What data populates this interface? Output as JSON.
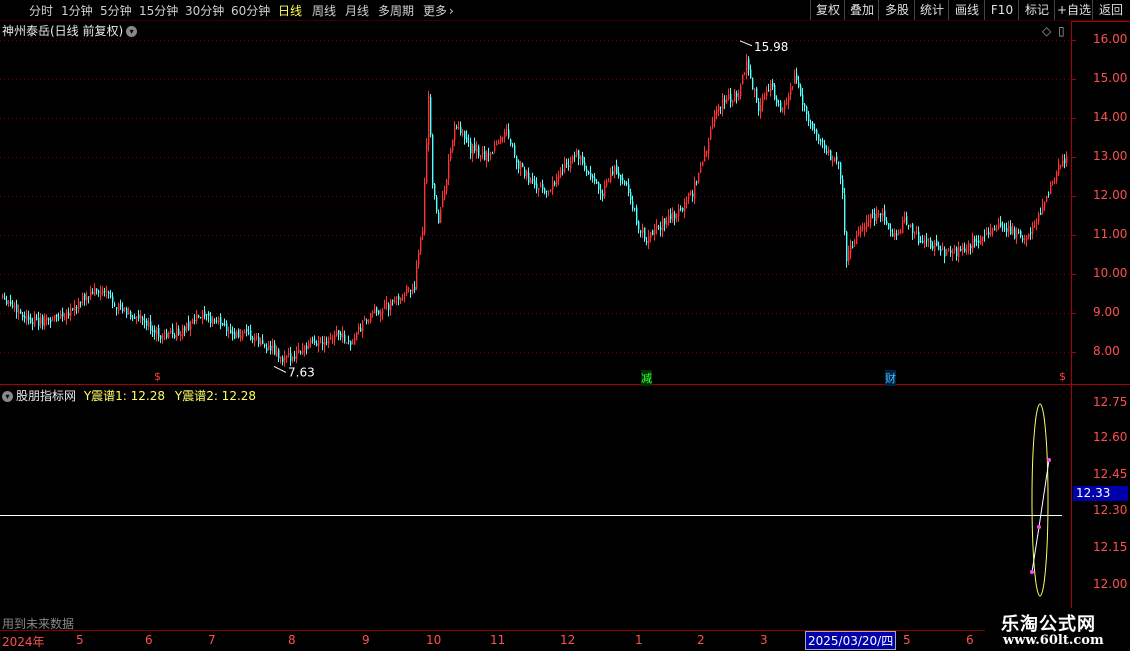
{
  "toolbar": {
    "periods": [
      "分时",
      "1分钟",
      "5分钟",
      "15分钟",
      "30分钟",
      "60分钟",
      "日线",
      "周线",
      "月线",
      "多周期",
      "更多"
    ],
    "active": "日线",
    "more_icon": "chevron-right-icon",
    "right_buttons": [
      "复权",
      "叠加",
      "多股",
      "统计",
      "画线",
      "F10",
      "标记",
      "+自选",
      "返回"
    ]
  },
  "main_chart": {
    "title": "神州泰岳(日线 前复权)",
    "max_label": "15.98",
    "min_label": "7.63",
    "y_ticks": [
      "16.00",
      "15.00",
      "14.00",
      "13.00",
      "12.00",
      "11.00",
      "10.00",
      "9.00",
      "8.00"
    ],
    "events": [
      {
        "label": "$",
        "color": "#ff4040"
      },
      {
        "label": "减",
        "color": "#40ff40"
      },
      {
        "label": "财",
        "color": "#40c0ff"
      },
      {
        "label": "$",
        "color": "#ff4040"
      }
    ]
  },
  "indicator": {
    "name": "股朋指标网",
    "series": [
      {
        "label": "Y震谱1: 12.28"
      },
      {
        "label": "Y震谱2: 12.28"
      }
    ],
    "y_ticks": [
      "12.75",
      "12.60",
      "12.45",
      "12.30",
      "12.15",
      "12.00"
    ],
    "current_price": "12.33",
    "future_note": "用到未来数据"
  },
  "date_axis": {
    "labels": [
      "2024年",
      "5",
      "6",
      "7",
      "8",
      "9",
      "10",
      "11",
      "12",
      "1",
      "2",
      "3",
      "2025/03/20/四",
      "5",
      "6"
    ]
  },
  "brand": {
    "name": "乐淘公式网",
    "url": "www.60lt.com"
  },
  "chart_data": {
    "type": "candlestick",
    "title": "神州泰岳(日线 前复权)",
    "ylim": [
      7.4,
      16.3
    ],
    "up_color": "#ff3232",
    "down_color": "#54ffff",
    "anchors": [
      [
        0,
        9.45
      ],
      [
        10,
        8.95
      ],
      [
        18,
        8.75
      ],
      [
        25,
        8.85
      ],
      [
        35,
        9.1
      ],
      [
        45,
        9.55
      ],
      [
        52,
        9.5
      ],
      [
        60,
        9.05
      ],
      [
        68,
        8.85
      ],
      [
        80,
        8.4
      ],
      [
        90,
        8.55
      ],
      [
        98,
        8.9
      ],
      [
        110,
        8.75
      ],
      [
        115,
        8.45
      ],
      [
        123,
        8.4
      ],
      [
        130,
        8.2
      ],
      [
        135,
        8.05
      ],
      [
        140,
        7.75
      ],
      [
        150,
        8.1
      ],
      [
        160,
        8.3
      ],
      [
        168,
        8.5
      ],
      [
        174,
        8.2
      ],
      [
        180,
        8.7
      ],
      [
        187,
        9.05
      ],
      [
        194,
        9.2
      ],
      [
        200,
        9.5
      ],
      [
        206,
        9.7
      ],
      [
        210,
        11.2
      ],
      [
        213,
        14.6
      ],
      [
        215,
        12.4
      ],
      [
        218,
        11.3
      ],
      [
        222,
        12.5
      ],
      [
        226,
        13.8
      ],
      [
        234,
        13.2
      ],
      [
        242,
        13.0
      ],
      [
        252,
        13.7
      ],
      [
        258,
        12.8
      ],
      [
        265,
        12.3
      ],
      [
        272,
        12.1
      ],
      [
        280,
        12.7
      ],
      [
        287,
        13.1
      ],
      [
        293,
        12.5
      ],
      [
        300,
        12.1
      ],
      [
        306,
        12.7
      ],
      [
        312,
        12.2
      ],
      [
        318,
        11.2
      ],
      [
        322,
        10.9
      ],
      [
        330,
        11.3
      ],
      [
        338,
        11.6
      ],
      [
        345,
        12.1
      ],
      [
        352,
        13.2
      ],
      [
        356,
        14.2
      ],
      [
        362,
        14.5
      ],
      [
        368,
        14.6
      ],
      [
        372,
        15.4
      ],
      [
        378,
        14.3
      ],
      [
        384,
        14.8
      ],
      [
        390,
        14.2
      ],
      [
        396,
        15.0
      ],
      [
        402,
        14.1
      ],
      [
        408,
        13.5
      ],
      [
        414,
        13.0
      ],
      [
        418,
        12.9
      ],
      [
        420,
        12.0
      ],
      [
        422,
        10.4
      ],
      [
        426,
        10.8
      ],
      [
        432,
        11.4
      ],
      [
        440,
        11.5
      ],
      [
        446,
        11.0
      ],
      [
        452,
        11.4
      ],
      [
        458,
        10.9
      ],
      [
        466,
        10.7
      ],
      [
        474,
        10.5
      ],
      [
        480,
        10.6
      ],
      [
        488,
        10.9
      ],
      [
        494,
        11.1
      ],
      [
        500,
        11.3
      ],
      [
        506,
        11.0
      ],
      [
        512,
        10.9
      ],
      [
        518,
        11.5
      ],
      [
        524,
        12.2
      ],
      [
        528,
        12.8
      ],
      [
        532,
        12.9
      ]
    ],
    "count": 533,
    "highs": [
      [
        369,
        15.98
      ]
    ],
    "lows": [
      [
        136,
        7.63
      ]
    ]
  }
}
